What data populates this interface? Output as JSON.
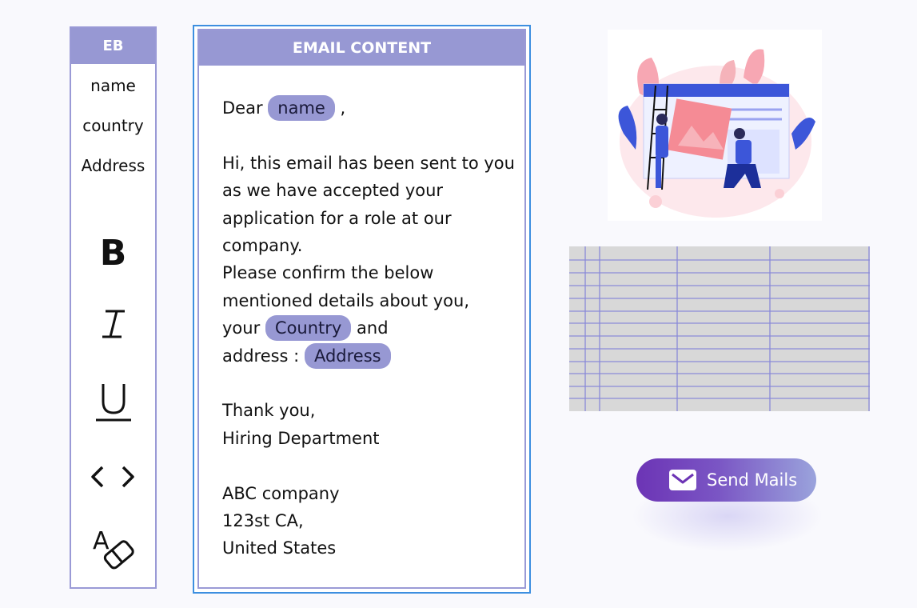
{
  "sidebar": {
    "title": "EB",
    "variables": [
      "name",
      "country",
      "Address"
    ],
    "tools": {
      "bold": "B",
      "italic": "I",
      "underline": "U"
    }
  },
  "email": {
    "title": "EMAIL CONTENT",
    "greeting_prefix": "Dear",
    "greeting_tag": "name",
    "greeting_suffix": ",",
    "para1": [
      "Hi, this email has been sent to you",
      "as we have accepted your",
      "application for a role at our",
      "company."
    ],
    "para2": [
      "Please confirm the below",
      "mentioned details about you,"
    ],
    "line_your": "your",
    "tag_country": "Country",
    "line_and": "and",
    "line_address": "address :",
    "tag_address": "Address",
    "closing1": "Thank you,",
    "closing2": "Hiring Department",
    "addr1": "ABC company",
    "addr2": "123st CA,",
    "addr3": "United States"
  },
  "send_button": {
    "label": "Send Mails"
  },
  "colors": {
    "accent": "#9798d3",
    "focus_border": "#3d8fe0",
    "button_start": "#6c34b5",
    "button_end": "#9aa3dc"
  }
}
